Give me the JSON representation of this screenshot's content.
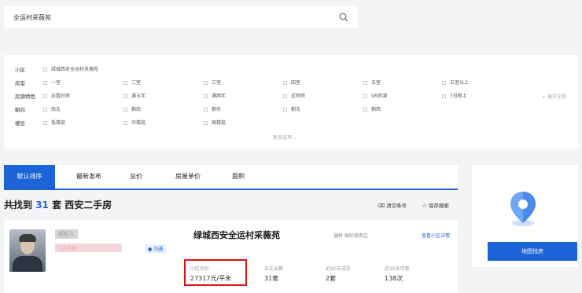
{
  "search": {
    "query": "全运村采薇苑"
  },
  "filters": {
    "rows": [
      {
        "label": "小区",
        "options": [
          "绿城西安全运村采薇苑"
        ]
      },
      {
        "label": "房型",
        "options": [
          "一室",
          "二室",
          "三室",
          "四室",
          "五室",
          "五室以上"
        ]
      },
      {
        "label": "房源特色",
        "options": [
          "必看好房",
          "满五年",
          "满两年",
          "近地铁",
          "VR房源",
          "7日新上"
        ]
      },
      {
        "label": "朝向",
        "options": [
          "南北",
          "朝南",
          "朝东",
          "朝北",
          "朝西"
        ]
      },
      {
        "label": "楼层",
        "options": [
          "低楼层",
          "中楼层",
          "高楼层"
        ]
      }
    ],
    "expand_all": "展开全部",
    "more_options": "更多选项"
  },
  "sort_tabs": [
    "默认排序",
    "最新发布",
    "总价",
    "房屋单价",
    "面积"
  ],
  "results": {
    "prefix": "共找到",
    "count": "31",
    "suffix": "套 西安二手房",
    "clear_conditions": "清空条件",
    "save_search": "保存搜索"
  },
  "community": {
    "name": "绿城西安全运村采薇苑",
    "address": "灞桥 国际港务区",
    "detail_link": "查看小区详情",
    "agent_name": "经纪人",
    "agent_info": "门店信息",
    "chat_label": "沟通",
    "stats": [
      {
        "label": "小区均价",
        "value": "27317元/平米"
      },
      {
        "label": "正在出售",
        "value": "31套"
      },
      {
        "label": "近90天成交",
        "value": "2套"
      },
      {
        "label": "近30天带看",
        "value": "138次"
      }
    ]
  },
  "map": {
    "button_label": "地图找房"
  },
  "colors": {
    "accent": "#1b63d6",
    "highlight_border": "#dd1111"
  }
}
